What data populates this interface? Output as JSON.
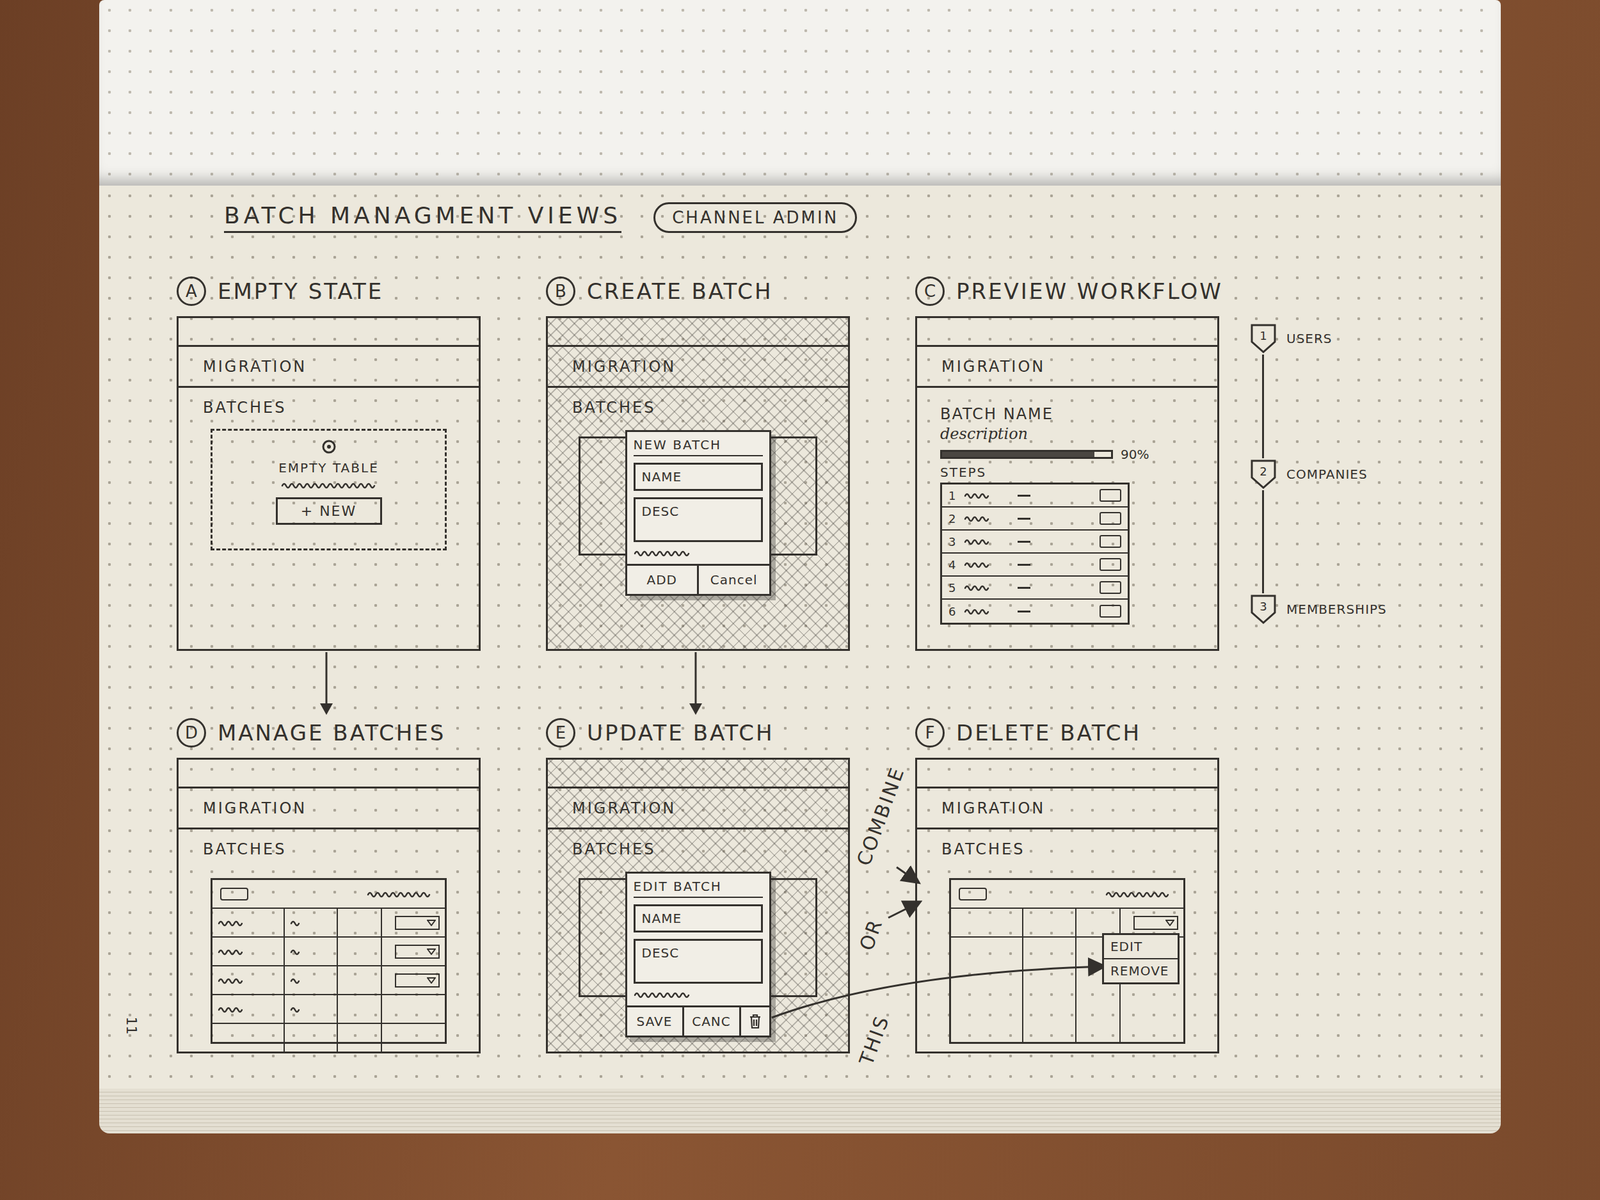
{
  "notebook": {
    "page_number": "11"
  },
  "header": {
    "title": "BATCH MANAGMENT VIEWS",
    "badge": "CHANNEL ADMIN"
  },
  "views": [
    {
      "letter": "A",
      "title": "EMPTY STATE",
      "kind": "empty",
      "app_title": "MIGRATION",
      "section": "BATCHES",
      "empty_text": "EMPTY TABLE",
      "button": "+ NEW",
      "arrow_to": "D"
    },
    {
      "letter": "B",
      "title": "CREATE BATCH",
      "kind": "modal",
      "app_title": "MIGRATION",
      "section": "BATCHES",
      "modal": {
        "title": "NEW BATCH",
        "fields": [
          {
            "label": "NAME",
            "multiline": false
          },
          {
            "label": "DESC",
            "multiline": true
          }
        ],
        "buttons": [
          "ADD",
          "Cancel"
        ],
        "trash": false
      },
      "arrow_to": "E"
    },
    {
      "letter": "C",
      "title": "PREVIEW WORKFLOW",
      "kind": "preview",
      "app_title": "MIGRATION",
      "batch_name": "BATCH NAME",
      "description": "description",
      "level": 0.9,
      "reading": "90%",
      "steps_label": "STEPS",
      "rows": [
        "1",
        "2",
        "3",
        "4",
        "5",
        "6"
      ],
      "workflow": [
        {
          "number": "1",
          "label": "USERS"
        },
        {
          "number": "2",
          "label": "COMPANIES"
        },
        {
          "number": "3",
          "label": "MEMBERSHIPS"
        }
      ]
    },
    {
      "letter": "D",
      "title": "MANAGE BATCHES",
      "kind": "table",
      "app_title": "MIGRATION",
      "section": "BATCHES",
      "rows": [
        {
          "filled": true,
          "has_menu": true,
          "menu_open": false
        },
        {
          "filled": true,
          "has_menu": true,
          "menu_open": false
        },
        {
          "filled": true,
          "has_menu": true,
          "menu_open": false
        },
        {
          "filled": true,
          "has_menu": false,
          "menu_open": false
        },
        {
          "filled": false,
          "has_menu": false,
          "menu_open": false
        }
      ],
      "menu": []
    },
    {
      "letter": "E",
      "title": "UPDATE BATCH",
      "kind": "modal",
      "app_title": "MIGRATION",
      "section": "BATCHES",
      "modal": {
        "title": "EDIT BATCH",
        "fields": [
          {
            "label": "NAME",
            "multiline": false
          },
          {
            "label": "DESC",
            "multiline": true
          }
        ],
        "buttons": [
          "SAVE",
          "CANC"
        ],
        "trash": true
      }
    },
    {
      "letter": "F",
      "title": "DELETE BATCH",
      "kind": "table",
      "app_title": "MIGRATION",
      "section": "BATCHES",
      "rows": [
        {
          "filled": false,
          "has_menu": true,
          "menu_open": true
        }
      ],
      "menu": [
        "EDIT",
        "REMOVE"
      ]
    }
  ],
  "annotations": {
    "combine": "COMBINE",
    "or": "OR",
    "this": "THIS"
  }
}
